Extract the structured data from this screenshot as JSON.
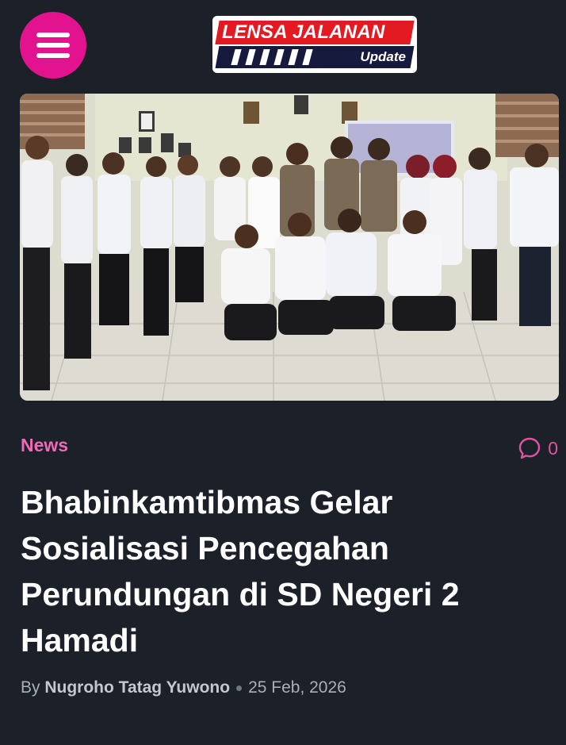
{
  "header": {
    "menu_icon": "hamburger-menu-icon",
    "logo": {
      "line1": "LENSA JALANAN",
      "line2": "Update"
    }
  },
  "colors": {
    "background": "#1b2029",
    "accent": "#e3138f",
    "category": "#f06ab7",
    "title": "#ffffff"
  },
  "article": {
    "image_alt_icon": "photo-image",
    "category": "News",
    "comment_icon": "comment-bubble-icon",
    "comment_count": "0",
    "title": "Bhabinkamtibmas Gelar Sosialisasi Pencegahan Perundungan di SD Negeri 2 Hamadi",
    "byline_prefix": "By",
    "author": "Nugroho Tatag Yuwono",
    "date": "25 Feb, 2026"
  }
}
